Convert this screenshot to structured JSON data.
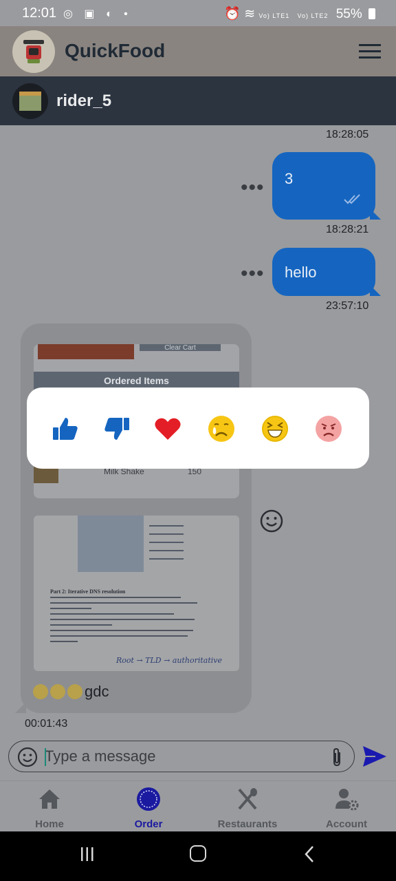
{
  "status_bar": {
    "time": "12:01",
    "sim1": "Vo) LTE1",
    "sim2": "Vo) LTE2",
    "battery": "55%"
  },
  "app": {
    "title": "QuickFood",
    "menu_icon": "hamburger-menu-icon"
  },
  "chat": {
    "contact_name": "rider_5",
    "messages": [
      {
        "type": "timestamp",
        "time": "18:28:05"
      },
      {
        "type": "outgoing",
        "text": "3",
        "time": "18:28:21",
        "status": "read"
      },
      {
        "type": "outgoing",
        "text": "hello",
        "time": "23:57:10"
      },
      {
        "type": "incoming",
        "attachments": {
          "order_card": {
            "clear_label": "Clear Cart",
            "header": "Ordered Items",
            "item_name": "Milk Shake",
            "item_price": "150"
          },
          "document": {
            "heading": "Part 2: Iterative DNS resolution",
            "handwriting": "Root → TLD → authoritative"
          }
        },
        "text": "gdc",
        "emojis": [
          "slightly-frowning",
          "unamused",
          "grinning-squinting"
        ],
        "time": "00:01:43"
      }
    ]
  },
  "reactions": [
    {
      "name": "like",
      "icon": "thumbs-up-icon",
      "color": "#1565c0"
    },
    {
      "name": "dislike",
      "icon": "thumbs-down-icon",
      "color": "#1565c0"
    },
    {
      "name": "love",
      "icon": "heart-icon",
      "color": "#e41e26"
    },
    {
      "name": "sad",
      "icon": "crying-face-icon",
      "color": "#f7c614"
    },
    {
      "name": "laugh",
      "icon": "laughing-face-icon",
      "color": "#f7c614"
    },
    {
      "name": "angry",
      "icon": "angry-face-icon",
      "color": "#f4a3a3"
    }
  ],
  "composer": {
    "placeholder": "Type a message"
  },
  "bottom_nav": {
    "items": [
      {
        "label": "Home",
        "icon": "home-icon",
        "active": false
      },
      {
        "label": "Order",
        "icon": "order-icon",
        "active": true
      },
      {
        "label": "Restaurants",
        "icon": "fork-knife-icon",
        "active": false
      },
      {
        "label": "Account",
        "icon": "account-gear-icon",
        "active": false
      }
    ]
  },
  "colors": {
    "accent": "#1565c0",
    "header_dark": "#2c3440",
    "active_nav": "#1a1aa0"
  }
}
